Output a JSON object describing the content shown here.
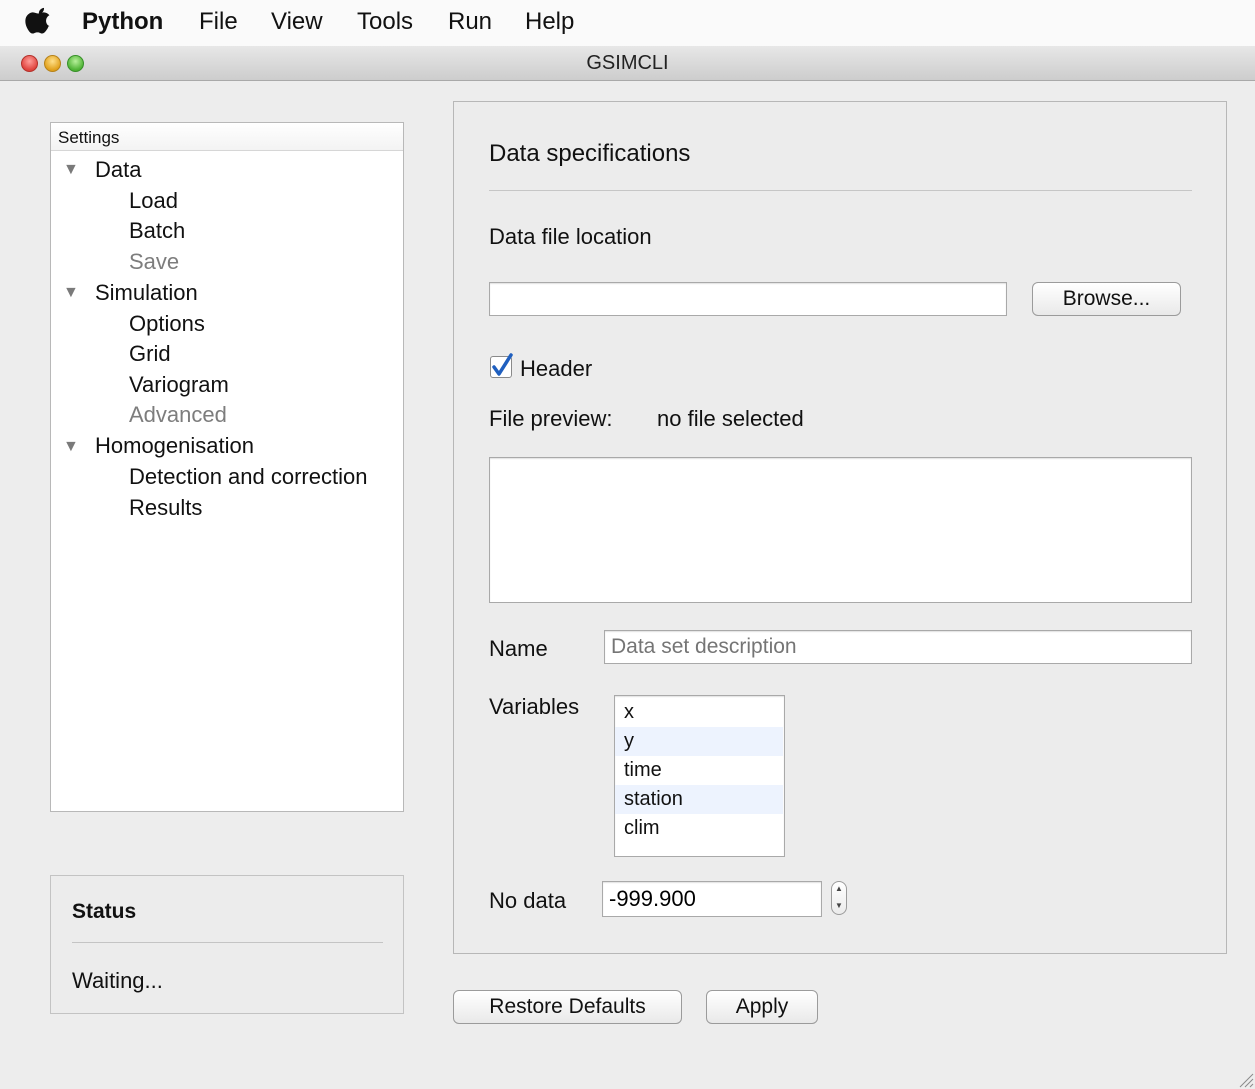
{
  "menubar": {
    "app": "Python",
    "items": [
      "File",
      "View",
      "Tools",
      "Run",
      "Help"
    ]
  },
  "window": {
    "title": "GSIMCLI"
  },
  "tree": {
    "header": "Settings",
    "groups": [
      {
        "label": "Data",
        "children": [
          {
            "label": "Load"
          },
          {
            "label": "Batch"
          },
          {
            "label": "Save",
            "disabled": true
          }
        ]
      },
      {
        "label": "Simulation",
        "children": [
          {
            "label": "Options"
          },
          {
            "label": "Grid"
          },
          {
            "label": "Variogram"
          },
          {
            "label": "Advanced",
            "disabled": true
          }
        ]
      },
      {
        "label": "Homogenisation",
        "children": [
          {
            "label": "Detection and correction"
          },
          {
            "label": "Results"
          }
        ]
      }
    ]
  },
  "status": {
    "title": "Status",
    "message": "Waiting..."
  },
  "main": {
    "section_title": "Data specifications",
    "file_location_label": "Data file location",
    "file_path": "",
    "browse_label": "Browse...",
    "header_label": "Header",
    "header_checked": true,
    "preview_label": "File preview:",
    "preview_value": "no file selected",
    "name_label": "Name",
    "name_placeholder": "Data set description",
    "variables_label": "Variables",
    "variables": [
      "x",
      "y",
      "time",
      "station",
      "clim"
    ],
    "nodata_label": "No data",
    "nodata_value": "-999.900"
  },
  "buttons": {
    "restore": "Restore Defaults",
    "apply": "Apply"
  }
}
